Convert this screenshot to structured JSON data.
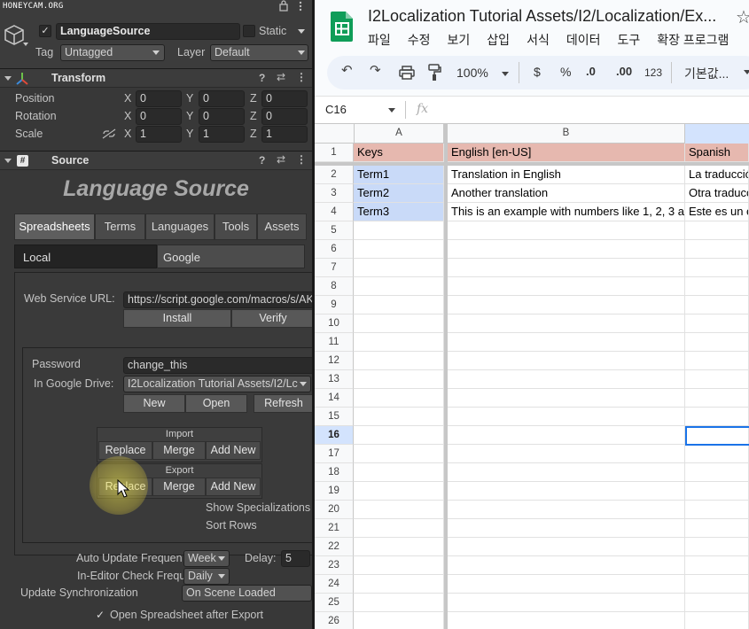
{
  "watermark": "HONEYCAM.ORG",
  "inspector": {
    "object_name": "LanguageSource",
    "static_label": "Static",
    "tag_label": "Tag",
    "tag_value": "Untagged",
    "layer_label": "Layer",
    "layer_value": "Default"
  },
  "transform": {
    "title": "Transform",
    "rows": [
      {
        "label": "Position",
        "x": "0",
        "y": "0",
        "z": "0"
      },
      {
        "label": "Rotation",
        "x": "0",
        "y": "0",
        "z": "0"
      },
      {
        "label": "Scale",
        "x": "1",
        "y": "1",
        "z": "1"
      }
    ],
    "axis": {
      "x": "X",
      "y": "Y",
      "z": "Z"
    }
  },
  "source": {
    "title": "Source",
    "banner": "Language Source",
    "tabs": [
      "Spreadsheets",
      "Terms",
      "Languages",
      "Tools",
      "Assets"
    ],
    "sub_tabs": [
      "Local",
      "Google"
    ],
    "web_service_label": "Web Service URL:",
    "web_service_value": "https://script.google.com/macros/s/AK",
    "install": "Install",
    "verify": "Verify",
    "password_label": "Password",
    "password_value": "change_this",
    "drive_label": "In Google Drive:",
    "drive_value": "I2Localization Tutorial Assets/I2/Lc",
    "new": "New",
    "open": "Open",
    "refresh": "Refresh",
    "import_title": "Import",
    "export_title": "Export",
    "replace": "Replace",
    "merge": "Merge",
    "add_new": "Add New",
    "show_spec": "Show Specializations",
    "sort_rows": "Sort Rows",
    "auto_update_label": "Auto Update Frequen",
    "auto_update_value": "Week",
    "delay_label": "Delay:",
    "delay_value": "5",
    "in_editor_label": "In-Editor Check Frequ",
    "in_editor_value": "Daily",
    "update_sync_label": "Update Synchronization",
    "update_sync_value": "On Scene Loaded",
    "open_after_export": "Open Spreadsheet after Export"
  },
  "sheets": {
    "doc_title": "I2Localization Tutorial Assets/I2/Localization/Ex...",
    "menu": [
      "파일",
      "수정",
      "보기",
      "삽입",
      "서식",
      "데이터",
      "도구",
      "확장 프로그램"
    ],
    "zoom": "100%",
    "currency": "$",
    "percent": "%",
    "dec_less": ".0",
    "dec_more": ".00",
    "num_format": "123",
    "font_name": "기본값...",
    "name_box": "C16",
    "fx": "fx",
    "columns": [
      "A",
      "B"
    ],
    "col_c_header": "",
    "rows": [
      {
        "n": "1",
        "a": "Keys",
        "b": "English [en-US]",
        "c": "Spanish"
      },
      {
        "n": "2",
        "a": "Term1",
        "b": "Translation in English",
        "c": "La traducció"
      },
      {
        "n": "3",
        "a": "Term2",
        "b": "Another translation",
        "c": "Otra traducc"
      },
      {
        "n": "4",
        "a": "Term3",
        "b": "This is an example with numbers like 1, 2, 3 a",
        "c": "Este es un e"
      },
      {
        "n": "5"
      },
      {
        "n": "6"
      },
      {
        "n": "7"
      },
      {
        "n": "8"
      },
      {
        "n": "9"
      },
      {
        "n": "10"
      },
      {
        "n": "11"
      },
      {
        "n": "12"
      },
      {
        "n": "13"
      },
      {
        "n": "14"
      },
      {
        "n": "15"
      },
      {
        "n": "16"
      },
      {
        "n": "17"
      },
      {
        "n": "18"
      },
      {
        "n": "19"
      },
      {
        "n": "20"
      },
      {
        "n": "21"
      },
      {
        "n": "22"
      },
      {
        "n": "23"
      },
      {
        "n": "24"
      },
      {
        "n": "25"
      },
      {
        "n": "26"
      }
    ],
    "selected_row": "16",
    "colors": {
      "header_fill": "#e6b8af",
      "key_fill": "#c9daf8",
      "selection": "#1a73e8"
    }
  }
}
